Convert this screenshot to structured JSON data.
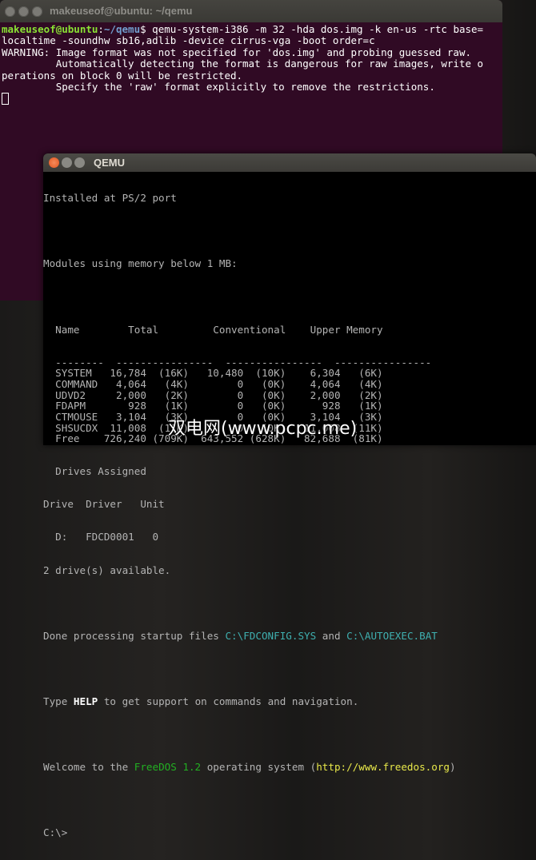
{
  "terminal": {
    "title": "makeuseof@ubuntu: ~/qemu",
    "prompt_user": "makeuseof@ubuntu",
    "prompt_sep": ":",
    "prompt_path": "~/qemu",
    "prompt_symbol": "$ ",
    "command_line1": "qemu-system-i386 -m 32 -hda dos.img -k en-us -rtc base=",
    "lines": [
      "localtime -soundhw sb16,adlib -device cirrus-vga -boot order=c",
      "WARNING: Image format was not specified for 'dos.img' and probing guessed raw.",
      "         Automatically detecting the format is dangerous for raw images, write o",
      "perations on block 0 will be restricted.",
      "         Specify the 'raw' format explicitly to remove the restrictions."
    ]
  },
  "qemu": {
    "title": "QEMU",
    "line_installed": "Installed at PS/2 port",
    "line_modules": "Modules using memory below 1 MB:",
    "headers": [
      "Name",
      "Total",
      "Conventional",
      "Upper Memory"
    ],
    "separator": "  --------  ----------------  ----------------  ----------------",
    "rows": [
      [
        "SYSTEM",
        "16,784",
        "(16K)",
        "10,480",
        "(10K)",
        "6,304",
        "(6K)"
      ],
      [
        "COMMAND",
        "4,064",
        "(4K)",
        "0",
        "(0K)",
        "4,064",
        "(4K)"
      ],
      [
        "UDVD2",
        "2,000",
        "(2K)",
        "0",
        "(0K)",
        "2,000",
        "(2K)"
      ],
      [
        "FDAPM",
        "928",
        "(1K)",
        "0",
        "(0K)",
        "928",
        "(1K)"
      ],
      [
        "CTMOUSE",
        "3,104",
        "(3K)",
        "0",
        "(0K)",
        "3,104",
        "(3K)"
      ],
      [
        "SHSUCDX",
        "11,008",
        "(11K)",
        "0",
        "(0K)",
        "11,008",
        "(11K)"
      ],
      [
        "Free",
        "726,240",
        "(709K)",
        "643,552",
        "(628K)",
        "82,688",
        "(81K)"
      ]
    ],
    "drives_assigned": "  Drives Assigned",
    "drives_header": "Drive  Driver   Unit",
    "drives_row": "  D:   FDCD0001   0",
    "drives_count": "2 drive(s) available.",
    "done_prefix": "Done processing startup files ",
    "done_file1": "C:\\FDCONFIG.SYS",
    "done_and": " and ",
    "done_file2": "C:\\AUTOEXEC.BAT",
    "help_prefix": "Type ",
    "help_word": "HELP",
    "help_suffix": " to get support on commands and navigation.",
    "welcome_prefix": "Welcome to the ",
    "welcome_os": "FreeDOS 1.2",
    "welcome_mid": " operating system (",
    "welcome_url": "http://www.freedos.org",
    "welcome_end": ")",
    "prompt": "C:\\>"
  },
  "watermark": "双电网(www.pcpc.me)",
  "colors": {
    "terminal_bg": "#300a24",
    "prompt_user": "#8ae234",
    "prompt_path": "#729fcf",
    "dos_cyan": "#3fb0b0",
    "dos_green": "#22b022",
    "dos_yellow": "#e8e84a"
  }
}
